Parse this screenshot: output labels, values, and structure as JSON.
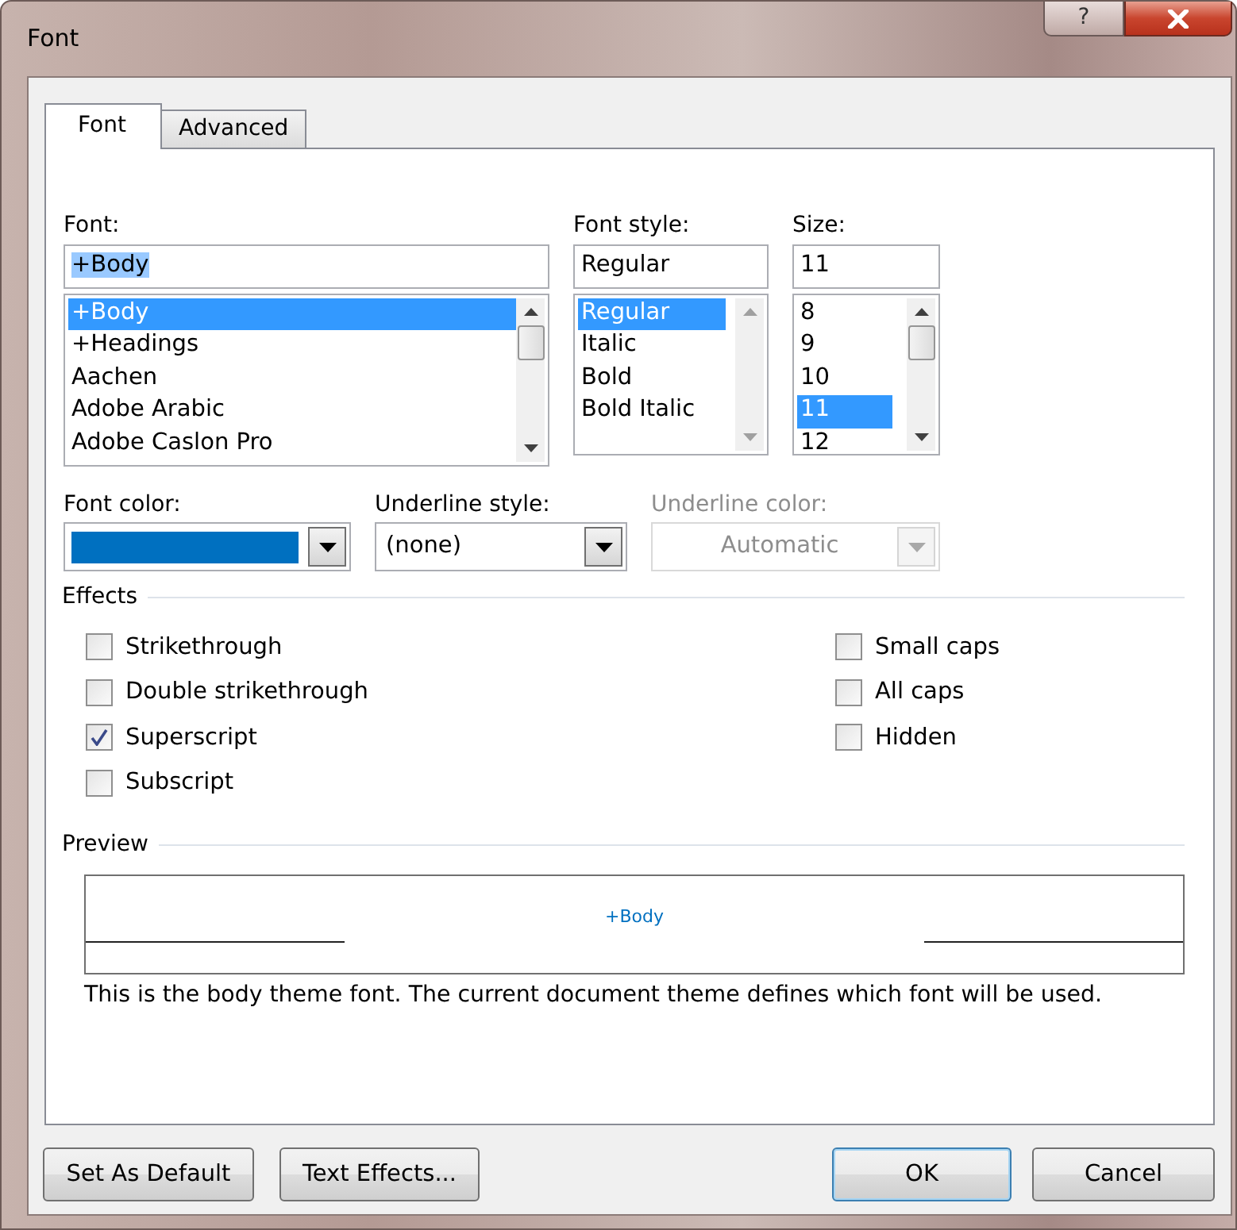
{
  "window": {
    "title": "Font",
    "help_button": "?"
  },
  "tabs": [
    {
      "label": "Font",
      "selected": true
    },
    {
      "label": "Advanced",
      "selected": false
    }
  ],
  "pickers": [
    {
      "label": "Font:",
      "value": "+Body",
      "items": [
        {
          "text": "+Body",
          "selected": true
        },
        {
          "text": "+Headings",
          "selected": false
        },
        {
          "text": "Aachen",
          "selected": false
        },
        {
          "text": "Adobe Arabic",
          "selected": false
        },
        {
          "text": "Adobe Caslon Pro",
          "selected": false
        }
      ]
    },
    {
      "label": "Font style:",
      "value": "Regular",
      "items": [
        {
          "text": "Regular",
          "selected": true
        },
        {
          "text": "Italic",
          "selected": false
        },
        {
          "text": "Bold",
          "selected": false
        },
        {
          "text": "Bold Italic",
          "selected": false
        }
      ]
    },
    {
      "label": "Size:",
      "value": "11",
      "items": [
        {
          "text": "8",
          "selected": false
        },
        {
          "text": "9",
          "selected": false
        },
        {
          "text": "10",
          "selected": false
        },
        {
          "text": "11",
          "selected": true
        },
        {
          "text": "12",
          "selected": false
        }
      ]
    }
  ],
  "dropdowns": [
    {
      "kind": "color",
      "label": "Font color:",
      "color": "#0070c0",
      "disabled": false
    },
    {
      "kind": "text",
      "label": "Underline style:",
      "value": "(none)",
      "disabled": false
    },
    {
      "kind": "text",
      "label": "Underline color:",
      "value": "Automatic",
      "disabled": true
    }
  ],
  "effects": {
    "title": "Effects",
    "columns": [
      [
        {
          "label": "Strikethrough",
          "checked": false
        },
        {
          "label": "Double strikethrough",
          "checked": false
        },
        {
          "label": "Superscript",
          "checked": true
        },
        {
          "label": "Subscript",
          "checked": false
        }
      ],
      [
        {
          "label": "Small caps",
          "checked": false
        },
        {
          "label": "All caps",
          "checked": false
        },
        {
          "label": "Hidden",
          "checked": false
        }
      ]
    ]
  },
  "preview": {
    "title": "Preview",
    "sample": "+Body",
    "description": "This is the body theme font. The current document theme defines which font will be used."
  },
  "footer": {
    "left_buttons": [
      {
        "label": "Set As Default",
        "default": false
      },
      {
        "label": "Text Effects...",
        "default": false
      }
    ],
    "right_buttons": [
      {
        "label": "OK",
        "default": true
      },
      {
        "label": "Cancel",
        "default": false
      }
    ]
  }
}
